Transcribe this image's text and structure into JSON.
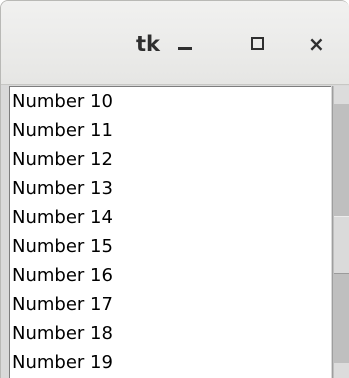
{
  "window": {
    "title": "tk"
  },
  "controls": {
    "minimize_icon": "minimize-icon",
    "maximize_icon": "maximize-icon",
    "close_icon": "close-icon",
    "close_symbol": "×"
  },
  "listbox": {
    "items": [
      "Number 10",
      "Number 11",
      "Number 12",
      "Number 13",
      "Number 14",
      "Number 15",
      "Number 16",
      "Number 17",
      "Number 18",
      "Number 19"
    ]
  },
  "colors": {
    "titlebar": "#e8e8e7",
    "listbox_background": "#ffffff",
    "scrollbar_trough": "#bfbfbf",
    "text": "#000000"
  }
}
